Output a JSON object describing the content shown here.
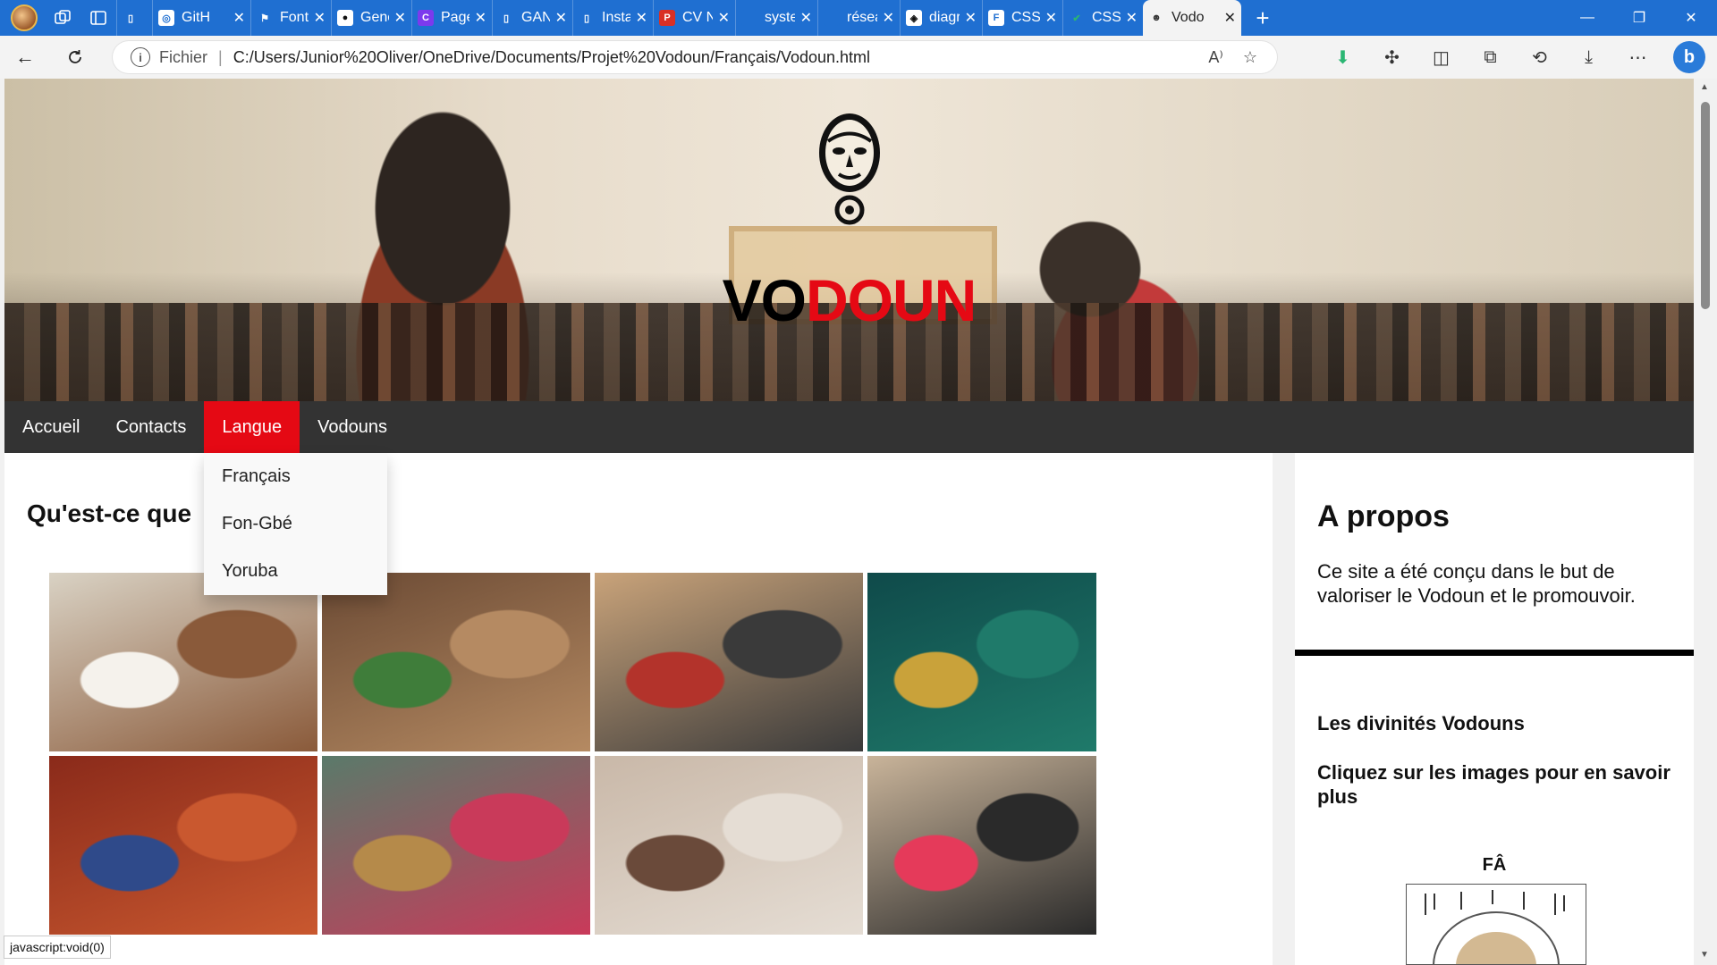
{
  "browser": {
    "tabs": [
      {
        "title": "GitH",
        "fav_bg": "#ffffff",
        "fav_fg": "#1f6fd1",
        "fav_glyph": "◎",
        "icon": "chatgpt-icon"
      },
      {
        "title": "Font",
        "fav_bg": "#1f6fd1",
        "fav_fg": "#ffffff",
        "fav_glyph": "⚑",
        "icon": "flag-icon"
      },
      {
        "title": "Gene",
        "fav_bg": "#ffffff",
        "fav_fg": "#111111",
        "fav_glyph": "●",
        "icon": "github-icon"
      },
      {
        "title": "Page",
        "fav_bg": "#7c3aed",
        "fav_fg": "#ffffff",
        "fav_glyph": "C",
        "icon": "canva-icon"
      },
      {
        "title": "GAN",
        "fav_bg": "#1f6fd1",
        "fav_fg": "#ffffff",
        "fav_glyph": "▯",
        "icon": "document-icon"
      },
      {
        "title": "Insta",
        "fav_bg": "#1f6fd1",
        "fav_fg": "#ffffff",
        "fav_glyph": "▯",
        "icon": "document-icon"
      },
      {
        "title": "CV N",
        "fav_bg": "#d93025",
        "fav_fg": "#ffffff",
        "fav_glyph": "P",
        "icon": "pdf-icon"
      },
      {
        "title": "syste",
        "fav_bg": "#1f6fd1",
        "fav_fg": "#ffffff",
        "fav_glyph": "",
        "icon": "page-icon"
      },
      {
        "title": "résea",
        "fav_bg": "#1f6fd1",
        "fav_fg": "#ffffff",
        "fav_glyph": "",
        "icon": "page-icon"
      },
      {
        "title": "diagr",
        "fav_bg": "#ffffff",
        "fav_fg": "#111111",
        "fav_glyph": "◈",
        "icon": "diagram-icon"
      },
      {
        "title": "CSS",
        "fav_bg": "#ffffff",
        "fav_fg": "#1f6fd1",
        "fav_glyph": "F",
        "icon": "css-icon"
      },
      {
        "title": "CSS",
        "fav_bg": "#1f6fd1",
        "fav_fg": "#2bb673",
        "fav_glyph": "✔",
        "icon": "check-icon"
      },
      {
        "title": "Vodo",
        "fav_bg": "#f3f3f3",
        "fav_fg": "#333333",
        "fav_glyph": "☻",
        "icon": "mask-icon",
        "active": true
      }
    ],
    "url_label": "Fichier",
    "url": "C:/Users/Junior%20Oliver/OneDrive/Documents/Projet%20Vodoun/Français/Vodoun.html",
    "tab_accent": "#1f6fd1"
  },
  "site": {
    "title_part1": "VO",
    "title_part2": "DOUN",
    "accent_color": "#e50914",
    "nav": [
      "Accueil",
      "Contacts",
      "Langue",
      "Vodouns"
    ],
    "nav_active_index": 2,
    "dropdown": [
      "Français",
      "Fon-Gbé",
      "Yoruba"
    ],
    "main_heading": "Qu'est-ce que",
    "gallery": [
      {
        "name": "photo-dancers-white",
        "colors": [
          "#d9d2c4",
          "#8a5a3a",
          "#f5f2ec"
        ]
      },
      {
        "name": "photo-shrine-woman",
        "colors": [
          "#6b4a34",
          "#b58a62",
          "#3f7d3a"
        ]
      },
      {
        "name": "photo-festival-dancer",
        "colors": [
          "#c9a37a",
          "#3a3a3a",
          "#b3332b"
        ]
      },
      {
        "name": "photo-mami-wata",
        "colors": [
          "#0f4a4a",
          "#1f7a6a",
          "#c9a23a"
        ]
      },
      {
        "name": "photo-egungun-masks",
        "colors": [
          "#8a2a1a",
          "#c9582f",
          "#2f4a8a"
        ]
      },
      {
        "name": "photo-zangbeto-costumes",
        "colors": [
          "#5a7a6a",
          "#c93a5a",
          "#b58a4a"
        ]
      },
      {
        "name": "photo-altar-serpent",
        "colors": [
          "#c9b8a8",
          "#e5ddd4",
          "#6a4a3a"
        ]
      },
      {
        "name": "photo-egungun-dance",
        "colors": [
          "#c9b49a",
          "#2a2a2a",
          "#e53a5a"
        ]
      }
    ],
    "side_title": "A propos",
    "side_text": "Ce site a été conçu dans le but de valoriser le Vodoun et le promouvoir.",
    "side_heading1": "Les divinités Vodouns",
    "side_heading2": "Cliquez sur les images pour en savoir plus",
    "side_fa_label": "FÂ"
  },
  "status_text": "javascript:void(0)"
}
